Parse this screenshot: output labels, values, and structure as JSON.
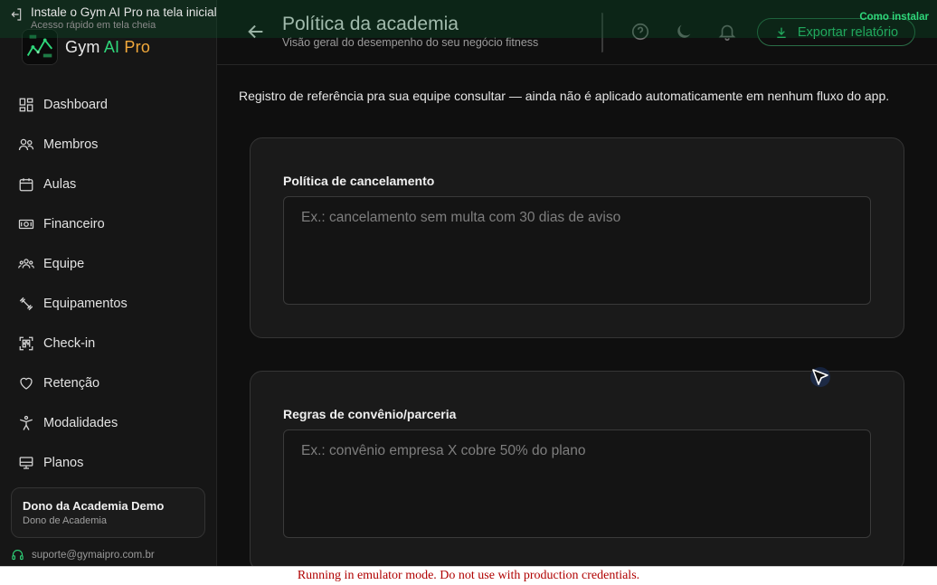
{
  "install_banner": {
    "title": "Instale o Gym AI Pro na tela inicial",
    "subtitle": "Acesso rápido em tela cheia",
    "link": "Como instalar"
  },
  "brand": {
    "part1": "Gym ",
    "part2": "AI",
    "part3": " Pro",
    "logo_text": "GYM AI PRO"
  },
  "sidebar": {
    "items": [
      {
        "label": "Dashboard",
        "icon": "dashboard-icon"
      },
      {
        "label": "Membros",
        "icon": "members-icon"
      },
      {
        "label": "Aulas",
        "icon": "calendar-icon"
      },
      {
        "label": "Financeiro",
        "icon": "money-icon"
      },
      {
        "label": "Equipe",
        "icon": "team-icon"
      },
      {
        "label": "Equipamentos",
        "icon": "equipment-icon"
      },
      {
        "label": "Check-in",
        "icon": "qr-icon"
      },
      {
        "label": "Retenção",
        "icon": "heart-icon"
      },
      {
        "label": "Modalidades",
        "icon": "modality-icon"
      },
      {
        "label": "Planos",
        "icon": "plans-icon"
      }
    ],
    "user": {
      "name": "Dono da Academia Demo",
      "role": "Dono de Academia"
    },
    "support_email": "suporte@gymaipro.com.br"
  },
  "header": {
    "title": "Política da academia",
    "subtitle": "Visão geral do desempenho do seu negócio fitness",
    "export_label": "Exportar relatório"
  },
  "main": {
    "intro": "Registro de referência pra sua equipe consultar — ainda não é aplicado automaticamente em nenhum fluxo do app.",
    "cards": [
      {
        "title": "Política de cancelamento",
        "value": "",
        "placeholder": "Ex.: cancelamento sem multa com 30 dias de aviso"
      },
      {
        "title": "Regras de convênio/parceria",
        "value": "",
        "placeholder": "Ex.: convênio empresa X cobre 50% do plano"
      }
    ]
  },
  "emulator_notice": "Running in emulator mode. Do not use with production credentials.",
  "colors": {
    "accent": "#2fd67a",
    "brand_orange": "#f2a93b",
    "background": "#0f0f0f",
    "warning": "#b00000"
  }
}
